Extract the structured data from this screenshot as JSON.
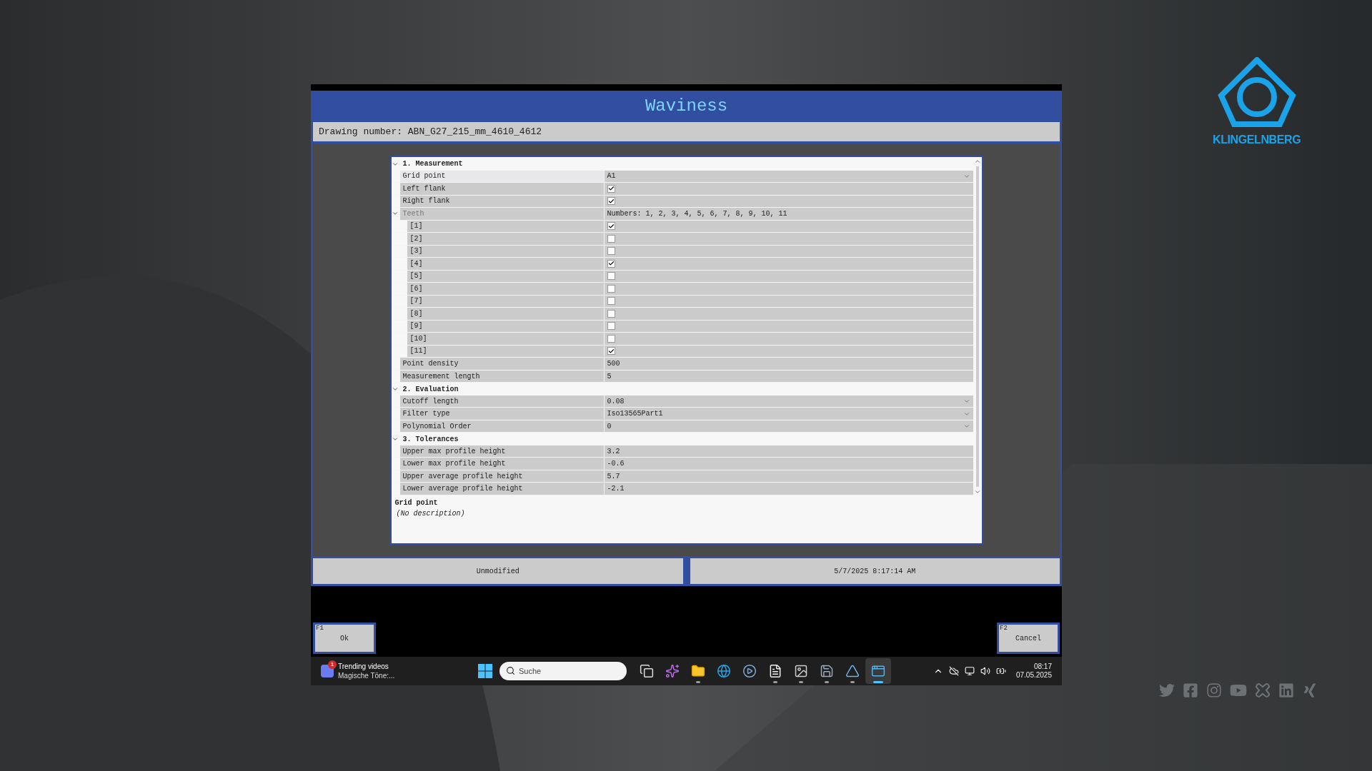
{
  "brand": {
    "name": "KLINGELNBERG"
  },
  "window": {
    "title": "Waviness",
    "drawing_number": "Drawing number: ABN_G27_215_mm_4610_4612"
  },
  "property_grid": {
    "sections": [
      {
        "title": "1. Measurement",
        "expanded": true,
        "rows": [
          {
            "kind": "dropdown",
            "label": "Grid point",
            "value": "A1",
            "selected": true
          },
          {
            "kind": "checkbox",
            "label": "Left flank",
            "checked": true,
            "selected": false
          },
          {
            "kind": "checkbox",
            "label": "Right flank",
            "checked": true,
            "selected": false
          },
          {
            "kind": "group",
            "label": "Teeth",
            "value": "Numbers: 1, 2, 3, 4, 5, 6, 7, 8, 9, 10, 11",
            "expanded": true,
            "selected": false,
            "children": [
              {
                "kind": "checkbox",
                "label": "[1]",
                "checked": true,
                "selected": false
              },
              {
                "kind": "checkbox",
                "label": "[2]",
                "checked": false,
                "selected": false
              },
              {
                "kind": "checkbox",
                "label": "[3]",
                "checked": false,
                "selected": false
              },
              {
                "kind": "checkbox",
                "label": "[4]",
                "checked": true,
                "selected": false
              },
              {
                "kind": "checkbox",
                "label": "[5]",
                "checked": false,
                "selected": false
              },
              {
                "kind": "checkbox",
                "label": "[6]",
                "checked": false,
                "selected": false
              },
              {
                "kind": "checkbox",
                "label": "[7]",
                "checked": false,
                "selected": false
              },
              {
                "kind": "checkbox",
                "label": "[8]",
                "checked": false,
                "selected": false
              },
              {
                "kind": "checkbox",
                "label": "[9]",
                "checked": false,
                "selected": false
              },
              {
                "kind": "checkbox",
                "label": "[10]",
                "checked": false,
                "selected": false
              },
              {
                "kind": "checkbox",
                "label": "[11]",
                "checked": true,
                "selected": false
              }
            ]
          },
          {
            "kind": "text",
            "label": "Point density",
            "value": "500",
            "selected": false
          },
          {
            "kind": "text",
            "label": "Measurement length",
            "value": "5",
            "selected": false
          }
        ]
      },
      {
        "title": "2. Evaluation",
        "expanded": true,
        "rows": [
          {
            "kind": "dropdown",
            "label": "Cutoff length",
            "value": "0.08",
            "selected": false
          },
          {
            "kind": "dropdown",
            "label": "Filter type",
            "value": "Iso13565Part1",
            "selected": false
          },
          {
            "kind": "dropdown",
            "label": "Polynomial Order",
            "value": "0",
            "selected": false
          }
        ]
      },
      {
        "title": "3. Tolerances",
        "expanded": true,
        "rows": [
          {
            "kind": "text",
            "label": "Upper max profile height",
            "value": "3.2",
            "selected": false
          },
          {
            "kind": "text",
            "label": "Lower max profile height",
            "value": "-0.6",
            "selected": false
          },
          {
            "kind": "text",
            "label": "Upper average profile height",
            "value": "5.7",
            "selected": false
          },
          {
            "kind": "text",
            "label": "Lower average profile height",
            "value": "-2.1",
            "selected": false
          }
        ]
      }
    ],
    "description": {
      "title": "Grid point",
      "text": "(No description)"
    }
  },
  "status_bar": [
    "Unmodified",
    "5/7/2025 8:17:14 AM"
  ],
  "buttons": [
    {
      "key": "F1",
      "label": "Ok"
    },
    {
      "key": "F2",
      "label": "Cancel"
    }
  ],
  "taskbar": {
    "widget": {
      "badge": "1",
      "title": "Trending videos",
      "subtitle": "Magische Töne:..."
    },
    "search": {
      "placeholder": "Suche"
    },
    "apps": [
      {
        "kind": "taskview",
        "running": false,
        "selected": false
      },
      {
        "kind": "copilot",
        "running": false,
        "selected": false
      },
      {
        "kind": "folder",
        "running": true,
        "selected": false
      },
      {
        "kind": "browser",
        "running": false,
        "selected": false
      },
      {
        "kind": "media",
        "running": false,
        "selected": false
      },
      {
        "kind": "file",
        "running": true,
        "selected": false
      },
      {
        "kind": "image",
        "running": true,
        "selected": false
      },
      {
        "kind": "disk",
        "running": true,
        "selected": false
      },
      {
        "kind": "ruler",
        "running": true,
        "selected": false
      },
      {
        "kind": "window",
        "running": true,
        "selected": true
      }
    ],
    "time": "08:17",
    "date": "07.05.2025"
  }
}
